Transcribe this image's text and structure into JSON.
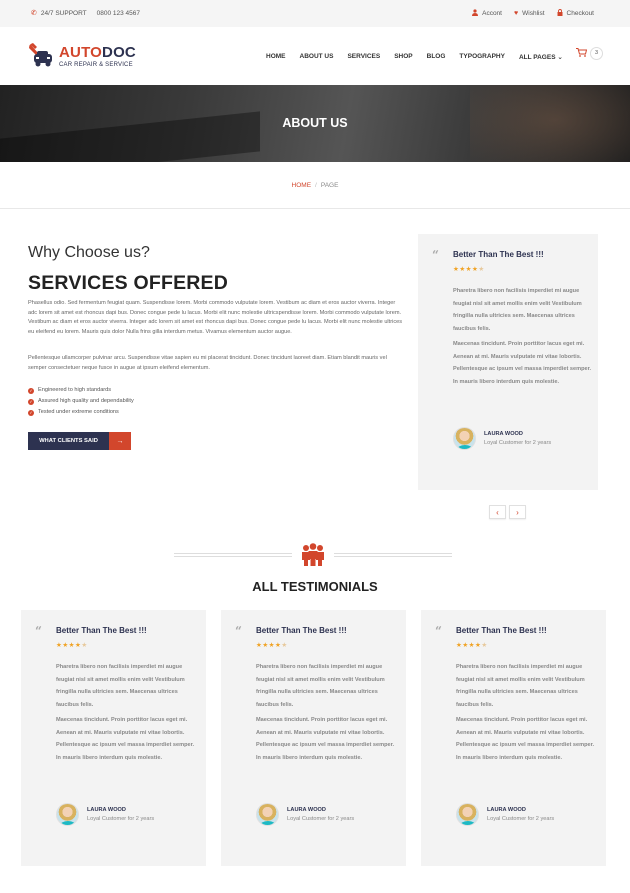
{
  "topbar": {
    "support_label": "24/7 SUPPORT",
    "phone": "0800 123 4567",
    "links": [
      {
        "icon": "user-icon",
        "label": "Accont"
      },
      {
        "icon": "heart-icon",
        "label": "Wishlist"
      },
      {
        "icon": "lock-icon",
        "label": "Checkout"
      }
    ]
  },
  "brand": {
    "name_part1": "AUTO",
    "name_part2": "DOC",
    "tagline": "CAR REPAIR & SERVICE",
    "colors": {
      "accent": "#d2462c",
      "navy": "#2d3250"
    }
  },
  "nav": {
    "items": [
      "HOME",
      "ABOUT US",
      "SERVICES",
      "SHOP",
      "BLOG",
      "TYPOGRAPHY",
      "ALL PAGES ⌄"
    ],
    "cart_count": "3"
  },
  "banner": {
    "title": "ABOUT US"
  },
  "breadcrumb": {
    "home": "HOME",
    "sep": "/",
    "current": "PAGE"
  },
  "about": {
    "subtitle": "Why Choose us?",
    "title": "SERVICES OFFERED",
    "paragraph1": "Phasellus odio. Sed fermentum feugiat quam. Suspendisse lorem. Morbi commodo vulputate lorem. Vestibum ac diam et eros auctor viverra. Integer adc lorem sit amet est rhoncus dapi bus. Donec congue pede lu lacus. Morbi elit nunc molestie ultricspendisse lorem. Morbi commodo vulputate lorem. Vestibum ac diam et eros auctor viverra. Integer adc lorem sit amet est rhoncus dapi bus. Donec congue pede lu lacus. Morbi elit nunc molestie ultrices eu eleifend eu lorem. Mauris quis dolor Nulla frins gilla interdum metus. Vivamus elementum auctor augue.",
    "paragraph2": "Pellentesque ullamcorper pulvinar arcu. Suspendisse vitae sapien eu mi placerat tincidunt. Donec tincidunt laoreet diam. Etiam blandit mauris vel semper consectetuer neque fusce in augue at ipsum eleifend elementum.",
    "checklist": [
      "Engineered to high standards",
      "Assured high quality and dependability",
      "Tested under extreme conditions"
    ],
    "cta_label": "WHAT CLIENTS SAID",
    "cta_arrow": "→"
  },
  "featured_testimonial": {
    "title": "Better Than The Best !!!",
    "rating": 4,
    "rating_max": 5,
    "text1": "Pharetra libero non facilisis imperdiet mi augue feugiat nisl sit amet mollis enim velit Vestibulum fringilla nulla ultricies sem. Maecenas ultrices faucibus felis.",
    "text2": "Maecenas tincidunt. Proin porttitor lacus eget mi. Aenean at mi. Mauris vulputate mi vitae lobortis. Pellentesque ac ipsum vel massa imperdiet semper. In mauris libero interdum quis molestie.",
    "author": "LAURA WOOD",
    "role": "Loyal Customer for 2 years",
    "prev": "‹",
    "next": "›"
  },
  "testimonials_section": {
    "title": "ALL TESTIMONIALS",
    "items": [
      {
        "title": "Better Than The Best !!!",
        "rating": 4,
        "text1": "Pharetra libero non facilisis imperdiet mi augue feugiat nisl sit amet mollis enim velit Vestibulum fringilla nulla ultricies sem. Maecenas ultrices faucibus felis.",
        "text2": "Maecenas tincidunt. Proin porttitor lacus eget mi. Aenean at mi. Mauris vulputate mi vitae lobortis. Pellentesque ac ipsum vel massa imperdiet semper. In mauris libero interdum quis molestie.",
        "author": "LAURA WOOD",
        "role": "Loyal Customer for 2 years"
      },
      {
        "title": "Better Than The Best !!!",
        "rating": 4,
        "text1": "Pharetra libero non facilisis imperdiet mi augue feugiat nisl sit amet mollis enim velit Vestibulum fringilla nulla ultricies sem. Maecenas ultrices faucibus felis.",
        "text2": "Maecenas tincidunt. Proin porttitor lacus eget mi. Aenean at mi. Mauris vulputate mi vitae lobortis. Pellentesque ac ipsum vel massa imperdiet semper. In mauris libero interdum quis molestie.",
        "author": "LAURA WOOD",
        "role": "Loyal Customer for 2 years"
      },
      {
        "title": "Better Than The Best !!!",
        "rating": 4,
        "text1": "Pharetra libero non facilisis imperdiet mi augue feugiat nisl sit amet mollis enim velit Vestibulum fringilla nulla ultricies sem. Maecenas ultrices faucibus felis.",
        "text2": "Maecenas tincidunt. Proin porttitor lacus eget mi. Aenean at mi. Mauris vulputate mi vitae lobortis. Pellentesque ac ipsum vel massa imperdiet semper. In mauris libero interdum quis molestie.",
        "author": "LAURA WOOD",
        "role": "Loyal Customer for 2 years"
      }
    ]
  }
}
